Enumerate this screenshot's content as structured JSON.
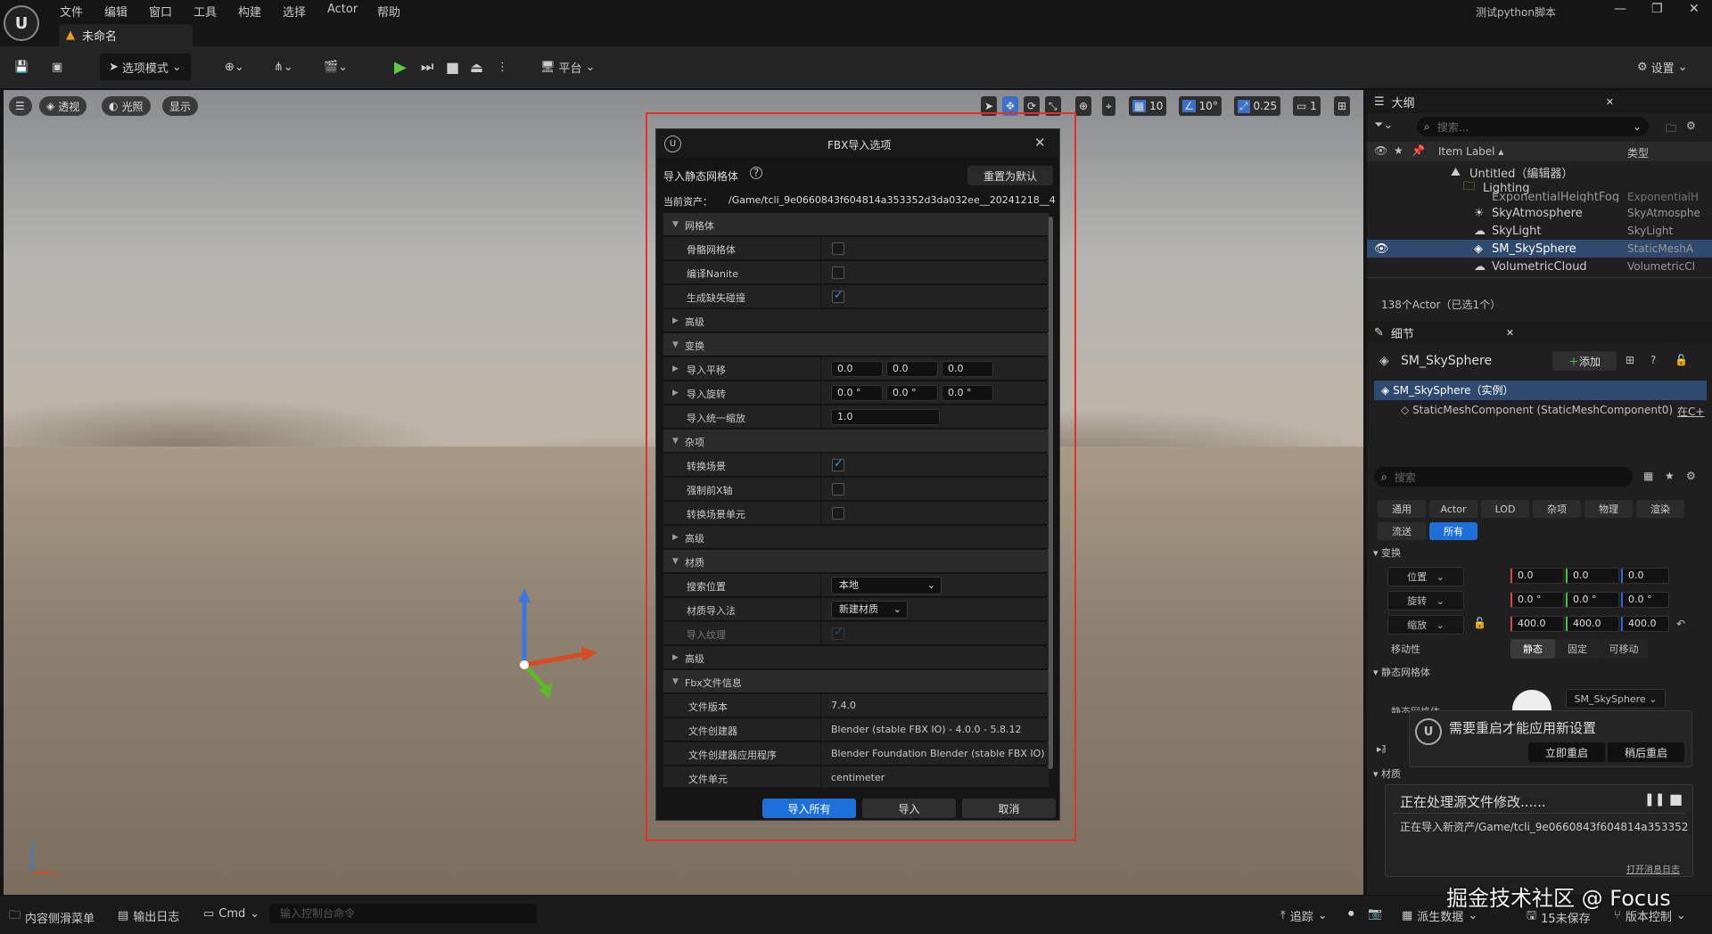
{
  "menubar": {
    "items": [
      "文件",
      "编辑",
      "窗口",
      "工具",
      "构建",
      "选择",
      "Actor",
      "帮助"
    ],
    "project_title": "测试python脚本",
    "tab_title": "未命名"
  },
  "toolbar": {
    "mode_label": "选项模式",
    "platform_label": "平台",
    "settings_label": "设置"
  },
  "viewport": {
    "perspective": "透视",
    "lighting": "光照",
    "show": "显示",
    "grid_snap": "10",
    "rot_snap": "10°",
    "scale_snap": "0.25",
    "camera_speed": "1"
  },
  "outliner": {
    "title": "大纲",
    "search_placeholder": "搜索...",
    "col_label": "Item Label",
    "col_type": "类型",
    "rows": [
      {
        "label": "Untitled（编辑器）",
        "type": ""
      },
      {
        "label": "Lighting",
        "type": ""
      },
      {
        "label": "ExponentialHeightFog",
        "type": "ExponentialH"
      },
      {
        "label": "SkyAtmosphere",
        "type": "SkyAtmosphe"
      },
      {
        "label": "SkyLight",
        "type": "SkyLight"
      },
      {
        "label": "SM_SkySphere",
        "type": "StaticMeshA"
      },
      {
        "label": "VolumetricCloud",
        "type": "VolumetricCl"
      }
    ],
    "footer": "138个Actor（已选1个）"
  },
  "details": {
    "title": "细节",
    "actor_name": "SM_SkySphere",
    "add_label": "添加",
    "instance_label": "SM_SkySphere（实例）",
    "component_label": "StaticMeshComponent (StaticMeshComponent0)",
    "component_suffix": "在C+",
    "search_placeholder": "搜索",
    "filter_tabs": [
      "通用",
      "Actor",
      "LOD",
      "杂项",
      "物理",
      "渲染",
      "流送",
      "所有"
    ],
    "transform_header": "变换",
    "location_label": "位置",
    "rotation_label": "旋转",
    "scale_label": "缩放",
    "location": [
      "0.0",
      "0.0",
      "0.0"
    ],
    "rotation": [
      "0.0 °",
      "0.0 °",
      "0.0 °"
    ],
    "scale": [
      "400.0",
      "400.0",
      "400.0"
    ],
    "mobility_label": "移动性",
    "mobility_options": [
      "静态",
      "固定",
      "可移动"
    ],
    "static_mesh_header": "静态网格体",
    "static_mesh_prop": "静态网格体",
    "static_mesh_value": "SM_SkySphere",
    "advanced_label": "高级",
    "materials_label": "材质"
  },
  "restart_notice": {
    "text": "需要重启才能应用新设置",
    "restart_now": "立即重启",
    "restart_later": "稍后重启"
  },
  "processing_notice": {
    "title": "正在处理源文件修改......",
    "detail": "正在导入新资产/Game/tcli_9e0660843f604814a353352d",
    "log_link": "打开消息日志"
  },
  "dialog": {
    "title": "FBX导入选项",
    "subtitle": "导入静态网格体",
    "reset_button": "重置为默认",
    "current_asset_label": "当前资产：",
    "current_asset_path": "/Game/tcli_9e0660843f604814a353352d3da032ee__20241218__4",
    "sections": {
      "mesh": "网格体",
      "transform": "变换",
      "misc": "杂项",
      "material": "材质",
      "fbx_info": "Fbx文件信息",
      "advanced": "高级"
    },
    "mesh_props": {
      "skeletal": "骨骼网格体",
      "nanite": "编译Nanite",
      "collision": "生成缺失碰撞"
    },
    "transform_props": {
      "translation": "导入平移",
      "rotation": "导入旋转",
      "uniform_scale": "导入统一缩放",
      "translation_vals": [
        "0.0",
        "0.0",
        "0.0"
      ],
      "rotation_vals": [
        "0.0 °",
        "0.0 °",
        "0.0 °"
      ],
      "scale_val": "1.0"
    },
    "misc_props": {
      "convert_scene": "转换场景",
      "force_front_x": "强制前X轴",
      "convert_scene_unit": "转换场景单元"
    },
    "material_props": {
      "search_location": "搜索位置",
      "search_location_val": "本地",
      "import_method": "材质导入法",
      "import_method_val": "新建材质",
      "import_textures": "导入纹理"
    },
    "fbx_props": {
      "file_version": "文件版本",
      "file_version_val": "7.4.0",
      "file_creator": "文件创建器",
      "file_creator_val": "Blender (stable FBX IO) - 4.0.0 - 5.8.12",
      "file_creator_app": "文件创建器应用程序",
      "file_creator_app_val": "Blender Foundation Blender (stable FBX IO)",
      "file_units": "文件单元",
      "file_units_val": "centimeter"
    },
    "import_all": "导入所有",
    "import": "导入",
    "cancel": "取消"
  },
  "statusbar": {
    "content_drawer": "内容侧滑菜单",
    "output_log": "输出日志",
    "cmd": "Cmd",
    "console_placeholder": "输入控制台命令",
    "trace": "追踪",
    "derived_data": "派生数据",
    "unsaved": "15未保存",
    "source_control": "版本控制"
  },
  "watermark": "掘金技术社区 @ Focus"
}
